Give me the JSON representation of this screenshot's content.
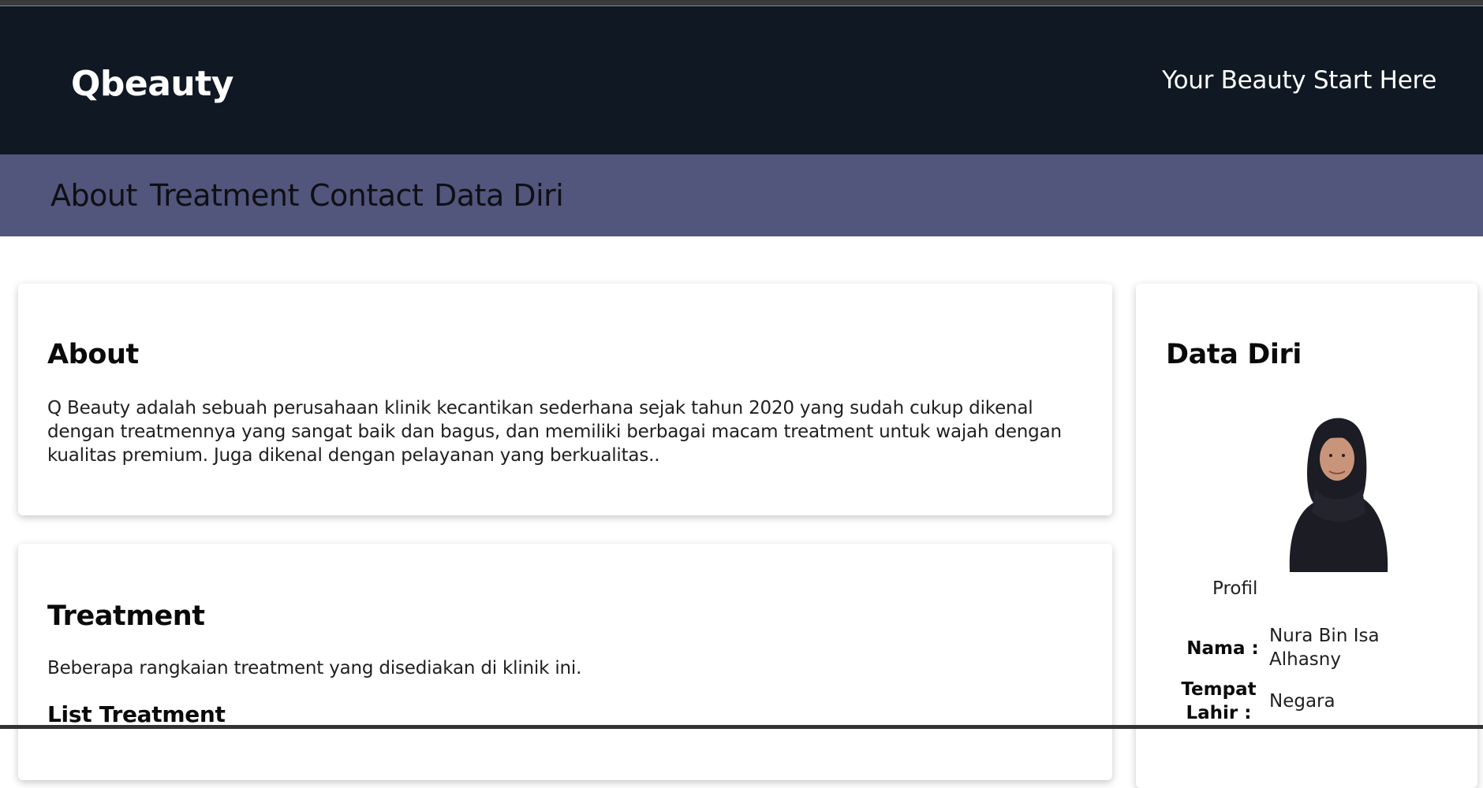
{
  "header": {
    "logo": "Qbeauty",
    "tagline": "Your Beauty Start Here"
  },
  "nav": {
    "items": [
      "About",
      "Treatment",
      "Contact",
      "Data Diri"
    ]
  },
  "about": {
    "title": "About",
    "text": "Q Beauty adalah sebuah perusahaan klinik kecantikan sederhana sejak tahun 2020 yang sudah cukup dikenal dengan treatmennya yang sangat baik dan bagus, dan memiliki berbagai macam treatment untuk wajah dengan kualitas premium. Juga dikenal dengan pelayanan yang berkualitas.."
  },
  "treatment": {
    "title": "Treatment",
    "text": "Beberapa rangkaian treatment yang disediakan di klinik ini.",
    "list_title": "List Treatment"
  },
  "data_diri": {
    "title": "Data Diri",
    "photo_caption": "Profil",
    "fields": [
      {
        "label": "Nama :",
        "value": "Nura Bin Isa Alhasny"
      },
      {
        "label": "Tempat Lahir :",
        "value": "Negara"
      }
    ]
  },
  "colors": {
    "header_bg": "#0f1823",
    "nav_bg": "#52567c"
  }
}
